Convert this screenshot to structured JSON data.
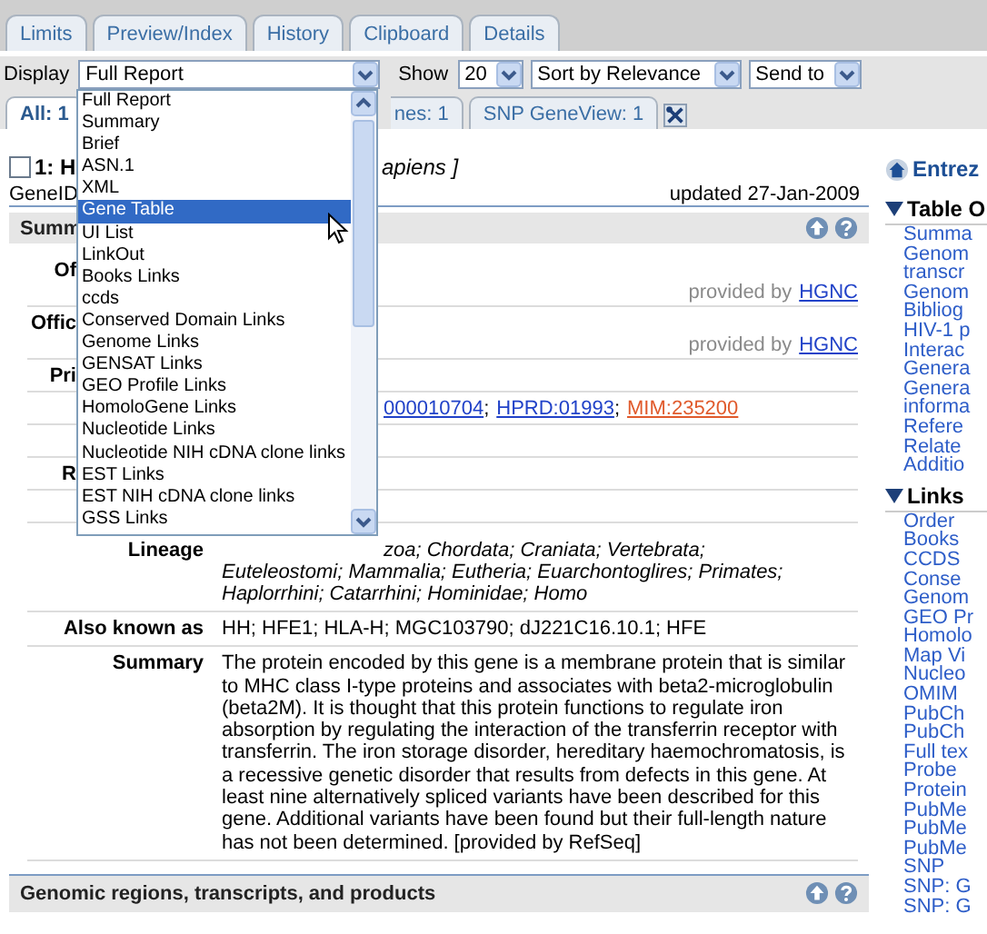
{
  "nav_tabs": [
    {
      "label": "Limits",
      "selected": false
    },
    {
      "label": "Preview/Index",
      "selected": false
    },
    {
      "label": "History",
      "selected": false
    },
    {
      "label": "Clipboard",
      "selected": false
    },
    {
      "label": "Details",
      "selected": false
    }
  ],
  "toolbar": {
    "display_label": "Display",
    "display_value": "Full Report",
    "show_label": "Show",
    "show_value": "20",
    "sort_value": "Sort by Relevance",
    "send_value": "Send to"
  },
  "display_options": [
    {
      "label": "Full Report",
      "selected": false
    },
    {
      "label": "Summary",
      "selected": false
    },
    {
      "label": "Brief",
      "selected": false
    },
    {
      "label": "ASN.1",
      "selected": false
    },
    {
      "label": "XML",
      "selected": false
    },
    {
      "label": "Gene Table",
      "selected": true
    },
    {
      "label": "UI List",
      "selected": false
    },
    {
      "label": "LinkOut",
      "selected": false
    },
    {
      "label": "Books Links",
      "selected": false
    },
    {
      "label": "ccds",
      "selected": false
    },
    {
      "label": "Conserved Domain Links",
      "selected": false
    },
    {
      "label": "Genome Links",
      "selected": false
    },
    {
      "label": "GENSAT Links",
      "selected": false
    },
    {
      "label": "GEO Profile Links",
      "selected": false
    },
    {
      "label": "HomoloGene Links",
      "selected": false
    },
    {
      "label": "Nucleotide Links",
      "selected": false
    },
    {
      "label": "Nucleotide NIH cDNA clone links",
      "selected": false
    },
    {
      "label": "EST Links",
      "selected": false
    },
    {
      "label": "EST NIH cDNA clone links",
      "selected": false
    },
    {
      "label": "GSS Links",
      "selected": false
    }
  ],
  "result_tabs": [
    {
      "label": "All: 1",
      "selected": true
    },
    {
      "label": "nes: 1",
      "selected": false
    },
    {
      "label": "SNP GeneView: 1",
      "selected": false
    }
  ],
  "record": {
    "checked": false,
    "title_head": "1: H",
    "title_tail": "apiens ]",
    "gene_id": "GeneID",
    "updated": "updated 27-Jan-2009"
  },
  "summary_section": {
    "title": "Summ"
  },
  "rows": [
    {
      "kind": "covered",
      "label": "Of",
      "provider": "provided by",
      "provider_link": "HGNC"
    },
    {
      "kind": "covered",
      "label": "Offic",
      "provider": "provided by",
      "provider_link": "HGNC"
    },
    {
      "kind": "covered",
      "label": "Pri"
    },
    {
      "kind": "covered",
      "parts": [
        {
          "kind": "link",
          "text": "000010704",
          "color": "#2142c8"
        },
        {
          "kind": "text",
          "text": ";"
        },
        {
          "kind": "link",
          "text": "HPRD:01993",
          "color": "#2142c8"
        },
        {
          "kind": "text",
          "text": ";"
        },
        {
          "kind": "link",
          "text": "MIM:235200",
          "color": "#e05a2c"
        }
      ]
    },
    {
      "kind": "covered"
    },
    {
      "kind": "covered",
      "label": "R"
    },
    {
      "kind": "covered"
    },
    {
      "kind": "lineage",
      "label": "Lineage",
      "lines": [
        "zoa; Chordata; Craniata; Vertebrata;",
        "Euteleostomi; Mammalia; Eutheria; Euarchontoglires; Primates;",
        "Haplorrhini; Catarrhini; Hominidae; Homo"
      ]
    },
    {
      "kind": "full",
      "label": "Also known as",
      "value": "HH; HFE1; HLA-H; MGC103790; dJ221C16.10.1; HFE"
    },
    {
      "kind": "full",
      "label": "Summary",
      "value": "The protein encoded by this gene is a membrane protein that is similar to MHC class I-type proteins and associates with beta2-microglobulin (beta2M). It is thought that this protein functions to regulate iron absorption by regulating the interaction of the transferrin receptor with transferrin. The iron storage disorder, hereditary haemochromatosis, is a recessive genetic disorder that results from defects in this gene. At least nine alternatively spliced variants have been described for this gene. Additional variants have been found but their full-length nature has not been determined. [provided by RefSeq]"
    }
  ],
  "genomic_section": {
    "title": "Genomic regions, transcripts, and products"
  },
  "sidebar": {
    "entrez": "Entrez",
    "toc": {
      "title": "Table O",
      "expanded": true,
      "items": [
        "Summa",
        "Genom",
        "transcr",
        "Genom",
        "Bibliog",
        "HIV-1 p",
        "Interac",
        "Genera",
        "Genera",
        "informa",
        "Refere",
        "Relate",
        "Additio"
      ]
    },
    "links": {
      "title": "Links",
      "expanded": true,
      "items": [
        "Order",
        "Books",
        "CCDS",
        "Conse",
        "Genom",
        "GEO Pr",
        "Homolo",
        "Map Vi",
        "Nucleo",
        "OMIM",
        "PubCh",
        "PubCh",
        "Full tex",
        "Probe",
        "Protein",
        "PubMe",
        "PubMe",
        "PubMe",
        "SNP",
        "SNP: G",
        "SNP: G"
      ]
    }
  }
}
